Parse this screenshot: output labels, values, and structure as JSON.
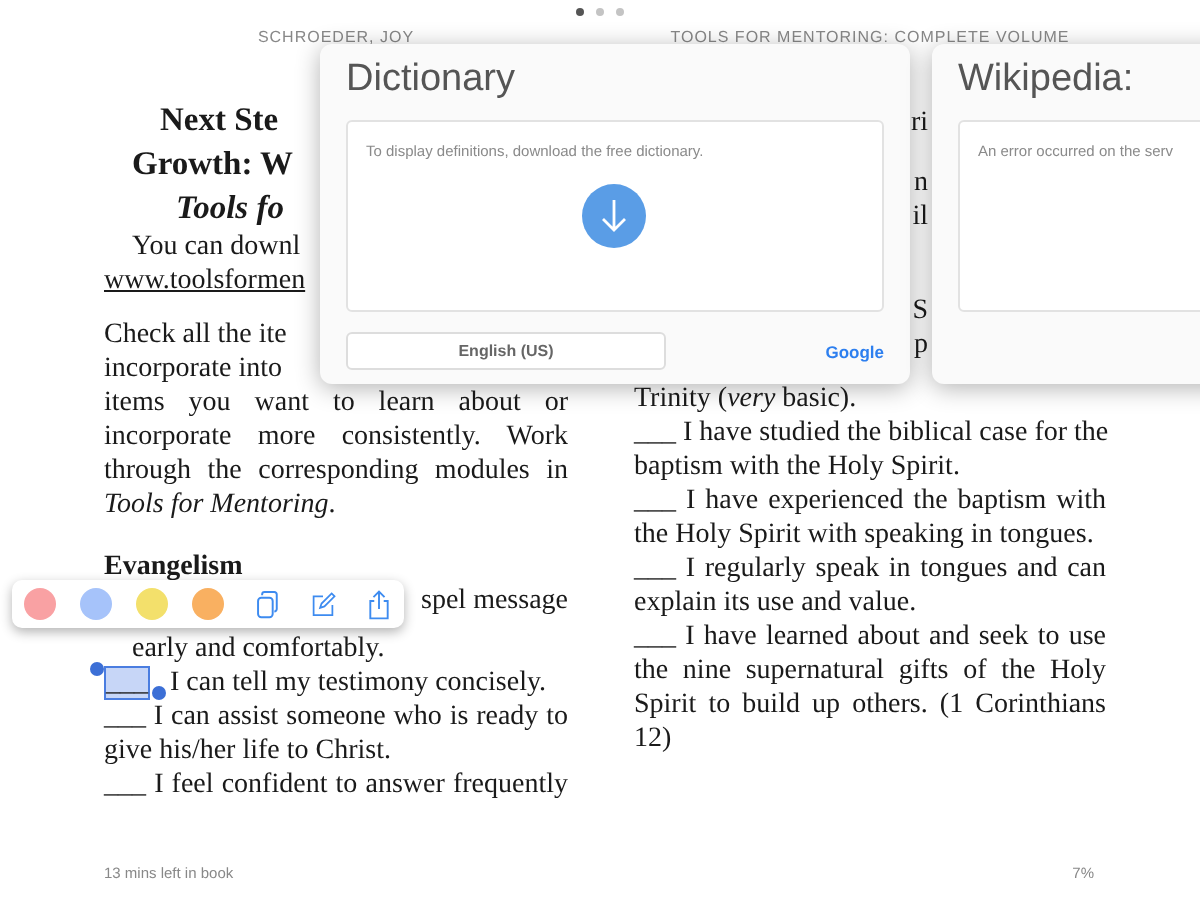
{
  "page_dots": [
    {
      "selected": true
    },
    {
      "selected": false
    },
    {
      "selected": false
    }
  ],
  "headers": {
    "left": "SCHROEDER, JOY",
    "right": "TOOLS FOR MENTORING: COMPLETE VOLUME"
  },
  "left_column": [
    {
      "lines": [
        {
          "kind": "title",
          "text": "Next Ste"
        },
        {
          "kind": "title",
          "text": "Growth: W"
        },
        {
          "kind": "title-italic",
          "text": "Tools fo"
        }
      ]
    },
    {
      "lines": [
        {
          "kind": "indent",
          "text": "You can downl"
        },
        {
          "kind": "link",
          "text": "www.toolsformen"
        }
      ]
    },
    {
      "lines": [
        {
          "kind": "plain",
          "text": "Check all the ite"
        },
        {
          "kind": "plain",
          "text": "incorporate into"
        },
        {
          "kind": "justified",
          "text": "items you want to learn about or"
        },
        {
          "kind": "justified",
          "text": "incorporate more consistently. Work"
        },
        {
          "kind": "justified",
          "text": "through the corresponding modules in"
        },
        {
          "kind": "plain",
          "text": "*Tools for Mentoring*."
        }
      ]
    },
    {
      "lines": [
        {
          "kind": "heading",
          "text": "Evangelism"
        },
        {
          "kind": "right",
          "text": "spel message"
        },
        {
          "kind": "indent",
          "text": "early and comfortably."
        },
        {
          "kind": "selected",
          "selected_text": "___",
          "text": "I can tell my testimony concisely."
        },
        {
          "kind": "justified",
          "text": "___ I can assist someone who is ready to"
        },
        {
          "kind": "plain",
          "text": "give his/her life to Christ."
        },
        {
          "kind": "justified",
          "text": "___ I feel confident to answer frequently"
        }
      ]
    }
  ],
  "right_column": [
    {
      "lines": [
        {
          "kind": "fragment",
          "text": "ri"
        }
      ]
    },
    {
      "lines": [
        {
          "kind": "fragment",
          "text": "n"
        },
        {
          "kind": "fragment",
          "text": "il"
        }
      ]
    },
    {
      "lines": [
        {
          "kind": "fragment",
          "text": "S"
        },
        {
          "kind": "fragment",
          "text": "p"
        }
      ]
    },
    {
      "lines": [
        {
          "kind": "plain",
          "text": "Trinity (*very* basic)."
        },
        {
          "kind": "justified",
          "text": "___ I have studied the biblical case for the"
        },
        {
          "kind": "plain",
          "text": "baptism with the Holy Spirit."
        },
        {
          "kind": "justified",
          "text": "___ I have experienced the baptism with"
        },
        {
          "kind": "plain",
          "text": "the Holy Spirit with speaking in tongues."
        },
        {
          "kind": "justified",
          "text": "___ I regularly speak in tongues and can"
        },
        {
          "kind": "plain",
          "text": "explain its use and value."
        },
        {
          "kind": "justified",
          "text": "___ I have learned about and seek to use"
        },
        {
          "kind": "justified",
          "text": "the nine supernatural gifts of the Holy"
        },
        {
          "kind": "justified",
          "text": "Spirit to build up others. (1 Corinthians"
        },
        {
          "kind": "plain",
          "text": "12)"
        }
      ]
    }
  ],
  "dictionary": {
    "title": "Dictionary",
    "message": "To display definitions, download the free dictionary.",
    "language_button": "English (US)",
    "link": "Google"
  },
  "wikipedia": {
    "title": "Wikipedia:",
    "message": "An error occurred on the serv"
  },
  "highlight_colors": [
    {
      "color": "#f9a1a3"
    },
    {
      "color": "#a6c3fa"
    },
    {
      "color": "#f3e06b"
    },
    {
      "color": "#f9b061"
    }
  ],
  "footer": {
    "time_left": "13 mins left in book",
    "percent": "7%"
  }
}
